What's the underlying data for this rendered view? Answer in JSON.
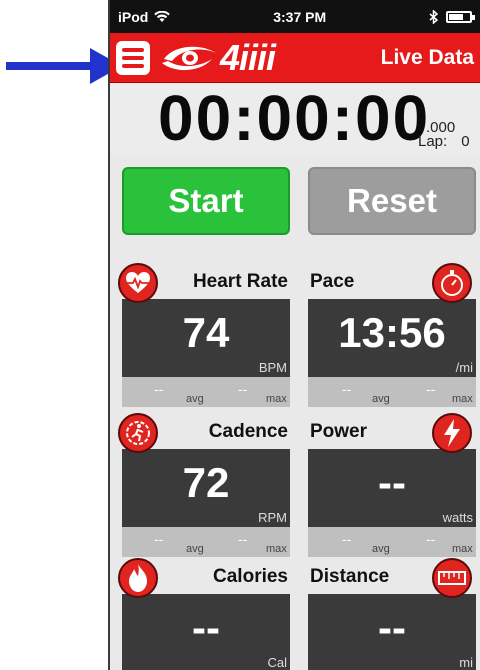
{
  "status_bar": {
    "carrier": "iPod",
    "time": "3:37 PM"
  },
  "nav": {
    "logo_text": "4iiii",
    "title": "Live Data"
  },
  "timer": {
    "display": "00:00:00",
    "fraction": ".000",
    "lap_label": "Lap:",
    "lap_value": "0"
  },
  "buttons": {
    "start": "Start",
    "reset": "Reset"
  },
  "metrics": {
    "heart_rate": {
      "title": "Heart Rate",
      "value": "74",
      "unit": "BPM",
      "avg": "--",
      "avg_label": "avg",
      "max": "--",
      "max_label": "max"
    },
    "pace": {
      "title": "Pace",
      "value": "13:56",
      "unit": "/mi",
      "avg": "--",
      "avg_label": "avg",
      "max": "--",
      "max_label": "max"
    },
    "cadence": {
      "title": "Cadence",
      "value": "72",
      "unit": "RPM",
      "avg": "--",
      "avg_label": "avg",
      "max": "--",
      "max_label": "max"
    },
    "power": {
      "title": "Power",
      "value": "--",
      "unit": "watts",
      "avg": "--",
      "avg_label": "avg",
      "max": "--",
      "max_label": "max"
    },
    "calories": {
      "title": "Calories",
      "value": "--",
      "unit": "Cal"
    },
    "distance": {
      "title": "Distance",
      "value": "--",
      "unit": "mi"
    }
  },
  "icons": {
    "pointer": "arrow-right-icon",
    "wifi": "wifi-icon",
    "bluetooth": "bluetooth-icon",
    "battery": "battery-icon",
    "menu": "menu-icon",
    "logo": "brand-logo",
    "heart": "heart-rate-icon",
    "stopwatch": "stopwatch-icon",
    "cadence": "cadence-icon",
    "power": "lightning-icon",
    "calories": "flame-icon",
    "distance": "ruler-icon"
  },
  "colors": {
    "accent": "#e61a1a",
    "start": "#29c23a",
    "reset": "#9d9d9d",
    "panel": "#3a3a3a",
    "arrow": "#2233cc"
  }
}
